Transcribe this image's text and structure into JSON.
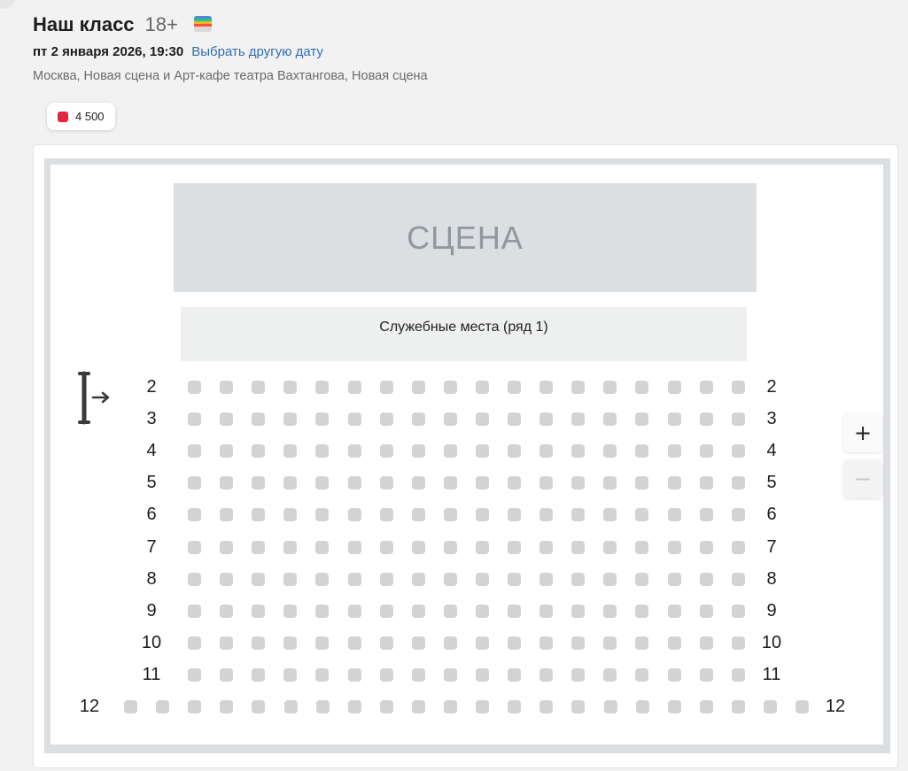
{
  "event": {
    "title": "Наш класс",
    "age_rating": "18+",
    "wallet_icon": "wallet-icon",
    "date": "пт 2 января 2026, 19:30",
    "change_date_link": "Выбрать другую дату",
    "venue": "Москва, Новая сцена и Арт-кафе театра Вахтангова, Новая сцена"
  },
  "prices": [
    {
      "label": "4 500",
      "color": "#e3263f"
    }
  ],
  "hall": {
    "stage_label": "СЦЕНА",
    "service_seats_label": "Служебные места (ряд 1)",
    "entrance_icon": "entrance-arrow-icon",
    "seat_color": "#d3d3d3",
    "rows": [
      {
        "number": "2",
        "seats": 18
      },
      {
        "number": "3",
        "seats": 18
      },
      {
        "number": "4",
        "seats": 18
      },
      {
        "number": "5",
        "seats": 18
      },
      {
        "number": "6",
        "seats": 18
      },
      {
        "number": "7",
        "seats": 18
      },
      {
        "number": "8",
        "seats": 18
      },
      {
        "number": "9",
        "seats": 18
      },
      {
        "number": "10",
        "seats": 18
      },
      {
        "number": "11",
        "seats": 18
      },
      {
        "number": "12",
        "seats": 22
      }
    ]
  },
  "zoom": {
    "zoom_in_label": "+",
    "zoom_out_label": "−"
  }
}
